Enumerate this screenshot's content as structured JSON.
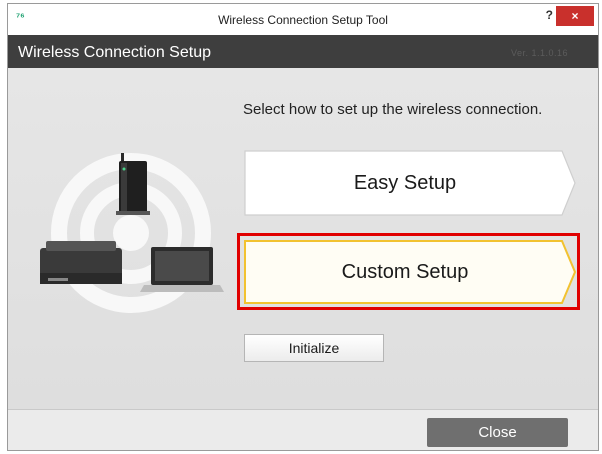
{
  "window": {
    "title": "Wireless Connection Setup Tool",
    "help_label": "?",
    "close_label": "×"
  },
  "header": {
    "title": "Wireless Connection Setup",
    "version": "Ver. 1.1.0.16"
  },
  "main": {
    "instruction": "Select how to set up the wireless connection.",
    "easy_setup_label": "Easy Setup",
    "custom_setup_label": "Custom Setup",
    "initialize_label": "Initialize"
  },
  "footer": {
    "close_label": "Close"
  },
  "colors": {
    "header_bg": "#3e3e3e",
    "highlight_border": "#e00000",
    "custom_accent": "#f2c230",
    "close_btn_bg": "#6f6f6f"
  },
  "icons": [
    "app-icon",
    "help-icon",
    "close-icon",
    "wireless-signal-icon",
    "router-icon",
    "scanner-icon",
    "laptop-icon"
  ]
}
